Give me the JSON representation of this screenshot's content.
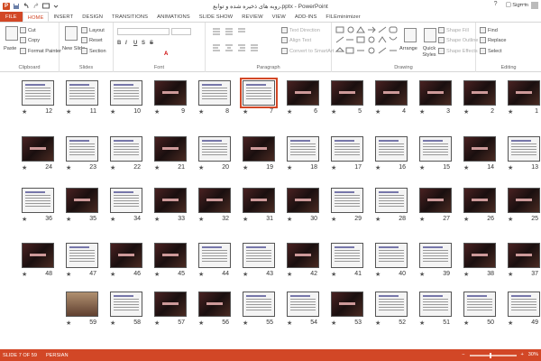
{
  "title_bar": {
    "title": "روبه های ذخیره شده و توابع.pptx - PowerPoint",
    "help": "?",
    "restore": "▢",
    "minimize": "—",
    "close": "✕",
    "logo": "P",
    "qa_save_icon": "save-icon",
    "qa_undo_icon": "undo-icon",
    "qa_redo_icon": "redo-icon",
    "qa_slideshow_icon": "slideshow-icon",
    "qa_more_icon": "more-icon"
  },
  "tabs": [
    "FILE",
    "HOME",
    "INSERT",
    "DESIGN",
    "TRANSITIONS",
    "ANIMATIONS",
    "SLIDE SHOW",
    "REVIEW",
    "VIEW",
    "ADD-INS",
    "FILEminimizer"
  ],
  "active_tab": "HOME",
  "sign_in": "Sign in",
  "ribbon": {
    "clipboard": {
      "label": "Clipboard",
      "paste": "Paste",
      "cut": "Cut",
      "copy": "Copy",
      "format_painter": "Format Painter"
    },
    "slides": {
      "label": "Slides",
      "new_slide": "New Slide",
      "layout": "Layout",
      "reset": "Reset",
      "section": "Section"
    },
    "font": {
      "label": "Font",
      "font_name": "",
      "font_size": "",
      "bold": "B",
      "italic": "I",
      "underline": "U",
      "strike": "S",
      "shadow": "S",
      "font_color": "A"
    },
    "paragraph": {
      "label": "Paragraph",
      "text_direction": "Text Direction",
      "align_text": "Align Text",
      "convert_smartart": "Convert to SmartArt"
    },
    "drawing": {
      "label": "Drawing",
      "arrange": "Arrange",
      "quick_styles": "Quick Styles",
      "shape_fill": "Shape Fill",
      "shape_outline": "Shape Outline",
      "shape_effects": "Shape Effects"
    },
    "editing": {
      "label": "Editing",
      "find": "Find",
      "replace": "Replace",
      "select": "Select"
    }
  },
  "slides": [
    {
      "n": "1",
      "k": "dark"
    },
    {
      "n": "2",
      "k": "dark"
    },
    {
      "n": "3",
      "k": "dark"
    },
    {
      "n": "4",
      "k": "dark"
    },
    {
      "n": "5",
      "k": "dark"
    },
    {
      "n": "6",
      "k": "dark"
    },
    {
      "n": "7",
      "k": "light",
      "sel": true
    },
    {
      "n": "8",
      "k": "light"
    },
    {
      "n": "9",
      "k": "dark"
    },
    {
      "n": "10",
      "k": "light"
    },
    {
      "n": "11",
      "k": "light"
    },
    {
      "n": "12",
      "k": "light"
    },
    {
      "n": "13",
      "k": "light"
    },
    {
      "n": "14",
      "k": "dark"
    },
    {
      "n": "15",
      "k": "light"
    },
    {
      "n": "16",
      "k": "light"
    },
    {
      "n": "17",
      "k": "light"
    },
    {
      "n": "18",
      "k": "light"
    },
    {
      "n": "19",
      "k": "dark"
    },
    {
      "n": "20",
      "k": "light"
    },
    {
      "n": "21",
      "k": "dark"
    },
    {
      "n": "22",
      "k": "light"
    },
    {
      "n": "23",
      "k": "light"
    },
    {
      "n": "24",
      "k": "dark"
    },
    {
      "n": "25",
      "k": "dark"
    },
    {
      "n": "26",
      "k": "dark"
    },
    {
      "n": "27",
      "k": "dark"
    },
    {
      "n": "28",
      "k": "light"
    },
    {
      "n": "29",
      "k": "light"
    },
    {
      "n": "30",
      "k": "dark"
    },
    {
      "n": "31",
      "k": "dark"
    },
    {
      "n": "32",
      "k": "dark"
    },
    {
      "n": "33",
      "k": "dark"
    },
    {
      "n": "34",
      "k": "light"
    },
    {
      "n": "35",
      "k": "dark"
    },
    {
      "n": "36",
      "k": "light"
    },
    {
      "n": "37",
      "k": "dark"
    },
    {
      "n": "38",
      "k": "dark"
    },
    {
      "n": "39",
      "k": "light"
    },
    {
      "n": "40",
      "k": "light"
    },
    {
      "n": "41",
      "k": "light"
    },
    {
      "n": "42",
      "k": "dark"
    },
    {
      "n": "43",
      "k": "light"
    },
    {
      "n": "44",
      "k": "light"
    },
    {
      "n": "45",
      "k": "dark"
    },
    {
      "n": "46",
      "k": "dark"
    },
    {
      "n": "47",
      "k": "light"
    },
    {
      "n": "48",
      "k": "dark"
    },
    {
      "n": "49",
      "k": "light"
    },
    {
      "n": "50",
      "k": "light"
    },
    {
      "n": "51",
      "k": "light"
    },
    {
      "n": "52",
      "k": "light"
    },
    {
      "n": "53",
      "k": "dark"
    },
    {
      "n": "54",
      "k": "light"
    },
    {
      "n": "55",
      "k": "light"
    },
    {
      "n": "56",
      "k": "dark"
    },
    {
      "n": "57",
      "k": "dark"
    },
    {
      "n": "58",
      "k": "light"
    },
    {
      "n": "59",
      "k": "photo"
    }
  ],
  "status": {
    "slide_info": "SLIDE 7 OF 59",
    "language": "PERSIAN",
    "zoom": "30%",
    "zoom_minus": "−",
    "zoom_plus": "+"
  },
  "colors": {
    "accent": "#d24726"
  }
}
